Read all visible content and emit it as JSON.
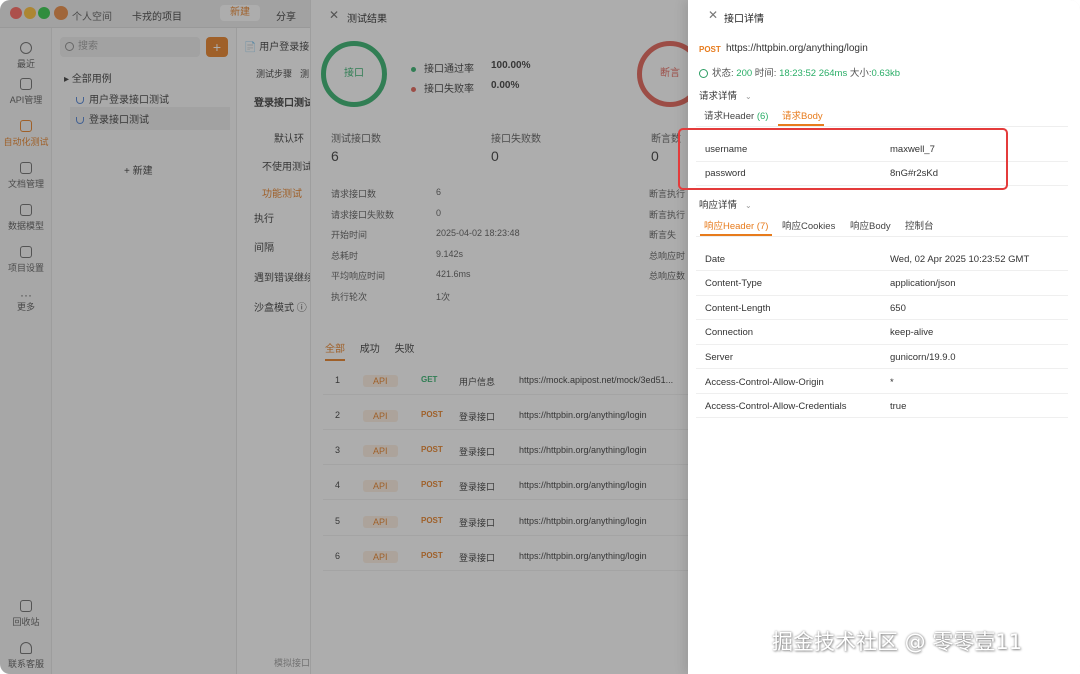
{
  "titlebar": {
    "team": "个人空间",
    "project": "卡戎的项目",
    "new_label": "新建",
    "share_label": "分享"
  },
  "nav": [
    {
      "label": "最近",
      "icon": "clock-icon"
    },
    {
      "label": "API管理",
      "icon": "api-icon"
    },
    {
      "label": "自动化测试",
      "icon": "test-icon"
    },
    {
      "label": "文档管理",
      "icon": "doc-icon"
    },
    {
      "label": "数据模型",
      "icon": "model-icon"
    },
    {
      "label": "项目设置",
      "icon": "settings-icon"
    },
    {
      "label": "更多",
      "icon": "more-icon"
    },
    {
      "label": "回收站",
      "icon": "trash-icon"
    },
    {
      "label": "联系客服",
      "icon": "headset-icon"
    }
  ],
  "tree": {
    "search_placeholder": "搜索",
    "all_cases": "全部用例",
    "items": [
      "用户登录接口测试",
      "登录接口测试"
    ],
    "new_label": "+ 新建"
  },
  "config": {
    "tab1": "测试步骤",
    "tab2": "测",
    "title": "登录接口测试",
    "default_env": "默认环",
    "no_test": "不使用测试",
    "func_test": "功能测试",
    "exec": "执行",
    "interval": "间隔",
    "on_error": "遇到错误继续",
    "sandbox": "沙盒模式 ⓘ",
    "footer": "模拟接口"
  },
  "result": {
    "title": "测试结果",
    "ring_label": "接口",
    "assert_label": "断言",
    "pass_label": "接口通过率",
    "pass_value": "100.00%",
    "fail_label": "接口失败率",
    "fail_value": "0.00%",
    "cards": [
      {
        "label": "测试接口数",
        "value": "6"
      },
      {
        "label": "接口失败数",
        "value": "0"
      },
      {
        "label": "断言数",
        "value": "0"
      }
    ],
    "details": [
      {
        "k": "请求接口数",
        "v": "6"
      },
      {
        "k": "请求接口失败数",
        "v": "0"
      },
      {
        "k": "开始时间",
        "v": "2025-04-02 18:23:48"
      },
      {
        "k": "总耗时",
        "v": "9.142s"
      },
      {
        "k": "平均响应时间",
        "v": "421.6ms"
      },
      {
        "k": "执行轮次",
        "v": "1次"
      }
    ],
    "details_right": [
      "断言执行",
      "断言执行",
      "断言失",
      "总响应时",
      "总响应数"
    ],
    "filters": [
      "全部",
      "成功",
      "失败"
    ],
    "rows": [
      {
        "n": "1",
        "type": "API",
        "method": "GET",
        "name": "用户信息",
        "url": "https://mock.apipost.net/mock/3ed51..."
      },
      {
        "n": "2",
        "type": "API",
        "method": "POST",
        "name": "登录接口",
        "url": "https://httpbin.org/anything/login"
      },
      {
        "n": "3",
        "type": "API",
        "method": "POST",
        "name": "登录接口",
        "url": "https://httpbin.org/anything/login"
      },
      {
        "n": "4",
        "type": "API",
        "method": "POST",
        "name": "登录接口",
        "url": "https://httpbin.org/anything/login"
      },
      {
        "n": "5",
        "type": "API",
        "method": "POST",
        "name": "登录接口",
        "url": "https://httpbin.org/anything/login"
      },
      {
        "n": "6",
        "type": "API",
        "method": "POST",
        "name": "登录接口",
        "url": "https://httpbin.org/anything/login"
      }
    ]
  },
  "detail": {
    "title": "接口详情",
    "method": "POST",
    "url": "https://httpbin.org/anything/login",
    "status_label": "状态:",
    "status_code": "200",
    "time_label": "时间:",
    "time_value": "18:23:52",
    "duration": "264ms",
    "size_label": "大小:",
    "size_value": "0.63kb",
    "request_section": "请求详情",
    "req_tabs": [
      {
        "label": "请求Header",
        "count": "(6)"
      },
      {
        "label": "请求Body"
      }
    ],
    "body_rows": [
      {
        "k": "username",
        "v": "maxwell_7"
      },
      {
        "k": "password",
        "v": "8nG#r2sKd"
      }
    ],
    "response_section": "响应详情",
    "resp_tabs": [
      "响应Header (7)",
      "响应Cookies",
      "响应Body",
      "控制台"
    ],
    "headers": [
      {
        "k": "Date",
        "v": "Wed, 02 Apr 2025 10:23:52 GMT"
      },
      {
        "k": "Content-Type",
        "v": "application/json"
      },
      {
        "k": "Content-Length",
        "v": "650"
      },
      {
        "k": "Connection",
        "v": "keep-alive"
      },
      {
        "k": "Server",
        "v": "gunicorn/19.9.0"
      },
      {
        "k": "Access-Control-Allow-Origin",
        "v": "*"
      },
      {
        "k": "Access-Control-Allow-Credentials",
        "v": "true"
      }
    ]
  },
  "watermark": "掘金技术社区 @ 零零壹11",
  "colors": {
    "accent": "#e77b1c",
    "success": "#2aae67",
    "fail": "#e25b4f",
    "highlight": "#e43b3b"
  }
}
